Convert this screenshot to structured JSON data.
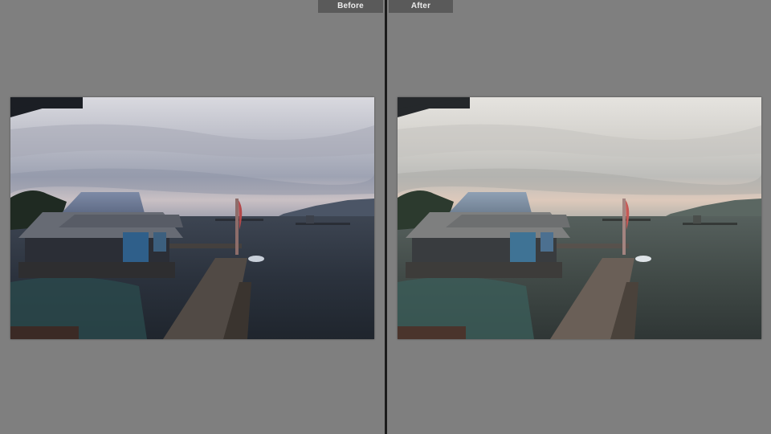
{
  "comparison": {
    "before_label": "Before",
    "after_label": "After"
  },
  "colors": {
    "background": "#7f7f7f",
    "divider": "#1b1b1b",
    "tab_background": "#5a5a5a",
    "tab_text": "#ececec"
  },
  "images": {
    "before": {
      "description_icon": "photo-before"
    },
    "after": {
      "description_icon": "photo-after"
    }
  }
}
